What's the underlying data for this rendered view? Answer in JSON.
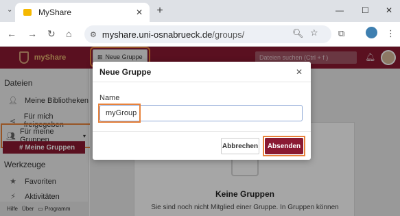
{
  "browser": {
    "tab_title": "MyShare",
    "url_host": "myshare.uni-osnabrueck.de",
    "url_path": "/groups/"
  },
  "app": {
    "logo_text": "myShare",
    "new_group_button": "Neue Gruppe",
    "search_placeholder": "Dateien suchen (Ctrl + f )"
  },
  "sidebar": {
    "section_files": "Dateien",
    "items": [
      {
        "label": "Meine Bibliotheken",
        "icon": "person-icon"
      },
      {
        "label": "Für mich freigegeben",
        "icon": "share-icon"
      },
      {
        "label": "Für meine Gruppen",
        "icon": "group-icon"
      }
    ],
    "active_sub": "# Meine Gruppen",
    "section_tools": "Werkzeuge",
    "tools": [
      {
        "label": "Favoriten",
        "icon": "star-icon"
      },
      {
        "label": "Aktivitäten",
        "icon": "activity-icon"
      }
    ],
    "footer": {
      "help": "Hilfe",
      "about": "Über",
      "program": "Programm"
    }
  },
  "main": {
    "empty_title": "Keine Gruppen",
    "empty_text": "Sie sind noch nicht Mitglied einer Gruppe. In Gruppen können"
  },
  "modal": {
    "title": "Neue Gruppe",
    "field_label": "Name",
    "field_value": "myGroup",
    "cancel": "Abbrechen",
    "submit": "Absenden"
  },
  "colors": {
    "brand": "#8a1a32",
    "highlight": "#e8823a"
  }
}
